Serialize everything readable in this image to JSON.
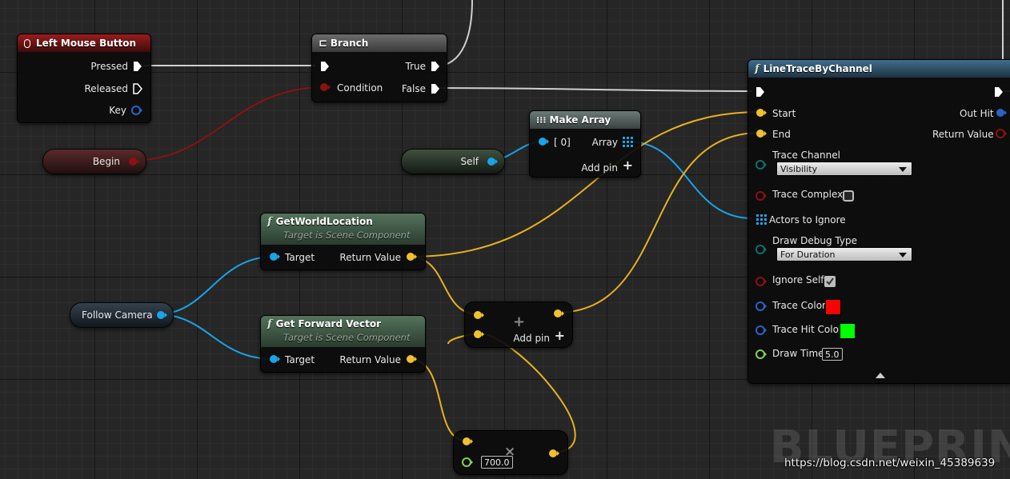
{
  "nodes": {
    "left_mouse": {
      "title": "Left Mouse Button",
      "pressed": "Pressed",
      "released": "Released",
      "key": "Key"
    },
    "branch": {
      "title": "Branch",
      "condition": "Condition",
      "true": "True",
      "false": "False"
    },
    "begin": {
      "label": "Begin"
    },
    "self": {
      "label": "Self"
    },
    "make_array": {
      "title": "Make Array",
      "index": "[ 0]",
      "array": "Array",
      "add_pin": "Add pin"
    },
    "get_world_location": {
      "title": "GetWorldLocation",
      "subtitle": "Target is Scene Component",
      "target": "Target",
      "return": "Return Value"
    },
    "get_forward_vector": {
      "title": "Get Forward Vector",
      "subtitle": "Target is Scene Component",
      "target": "Target",
      "return": "Return Value"
    },
    "follow_camera": {
      "label": "Follow Camera"
    },
    "add_node": {
      "add_pin": "Add pin"
    },
    "multiply_node": {
      "value": "700.0"
    },
    "line_trace": {
      "title": "LineTraceByChannel",
      "start": "Start",
      "end": "End",
      "out_hit": "Out Hit",
      "return": "Return Value",
      "trace_channel": "Trace Channel",
      "trace_channel_value": "Visibility",
      "trace_complex": "Trace Complex",
      "actors_to_ignore": "Actors to Ignore",
      "draw_debug_type": "Draw Debug Type",
      "draw_debug_value": "For Duration",
      "ignore_self": "Ignore Self",
      "trace_color": "Trace Color",
      "trace_hit_color": "Trace Hit Color",
      "draw_time": "Draw Time",
      "draw_time_value": "5.0"
    }
  },
  "colors": {
    "exec": "#ffffff",
    "vector": "#f0c030",
    "object": "#1aa3e8",
    "bool": "#8b1212",
    "float": "#86d050",
    "byte": "#0c6f6a",
    "struct": "#2a62c8",
    "trace_color": "#ff0000",
    "trace_hit_color": "#00ff00"
  },
  "watermark": "BLUEPRINT",
  "credit": "https://blog.csdn.net/weixin_45389639"
}
